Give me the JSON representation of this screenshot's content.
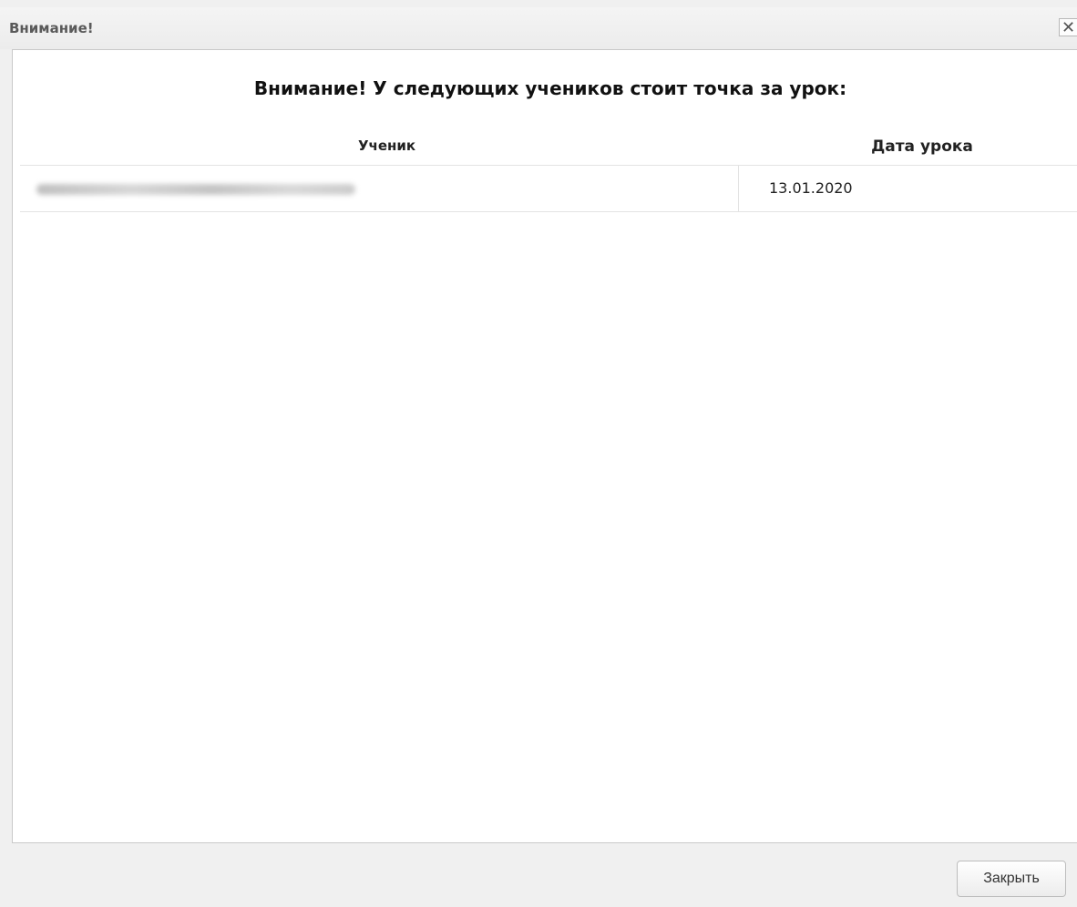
{
  "window": {
    "title": "Внимание!",
    "close_icon": "close-icon",
    "close_glyph": "✕"
  },
  "dialog": {
    "heading": "Внимание! У следующих учеников стоит точка за урок:"
  },
  "table": {
    "columns": [
      "Ученик",
      "Дата урока"
    ],
    "rows": [
      {
        "student": "",
        "date": "13.01.2020"
      }
    ]
  },
  "footer": {
    "close_label": "Закрыть"
  }
}
